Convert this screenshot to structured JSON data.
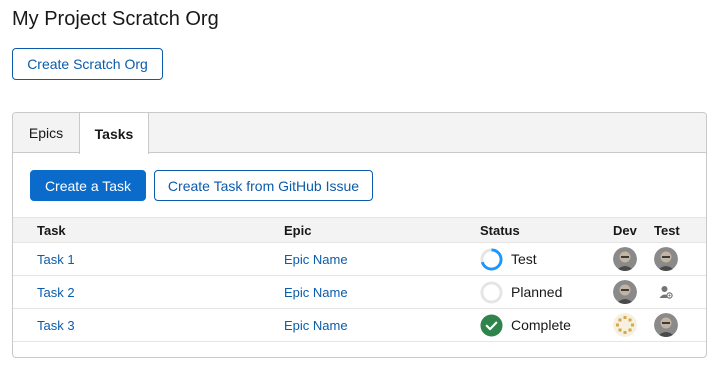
{
  "page": {
    "title": "My Project Scratch Org"
  },
  "actions": {
    "create_org": "Create Scratch Org"
  },
  "tabs": [
    {
      "label": "Epics",
      "active": false
    },
    {
      "label": "Tasks",
      "active": true
    }
  ],
  "toolbar": {
    "create_task": "Create a Task",
    "create_from_github": "Create Task from GitHub Issue"
  },
  "table": {
    "headers": {
      "task": "Task",
      "epic": "Epic",
      "status": "Status",
      "dev": "Dev",
      "test": "Test"
    },
    "rows": [
      {
        "task": "Task 1",
        "epic": "Epic Name",
        "status": "Test",
        "status_icon": "progress-ring-icon",
        "status_progress": 0.7,
        "dev": "avatar",
        "test": "avatar"
      },
      {
        "task": "Task 2",
        "epic": "Epic Name",
        "status": "Planned",
        "status_icon": "empty-ring-icon",
        "status_progress": 0,
        "dev": "avatar",
        "test": "assign-user-icon"
      },
      {
        "task": "Task 3",
        "epic": "Epic Name",
        "status": "Complete",
        "status_icon": "check-circle-icon",
        "status_progress": 1,
        "dev": "avatar-placeholder",
        "test": "avatar"
      }
    ]
  },
  "colors": {
    "brand": "#0b6bcb",
    "link": "#0b5cab",
    "progress": "#1b96ff",
    "complete": "#2e844a",
    "ring_track": "#e5e5e5"
  }
}
